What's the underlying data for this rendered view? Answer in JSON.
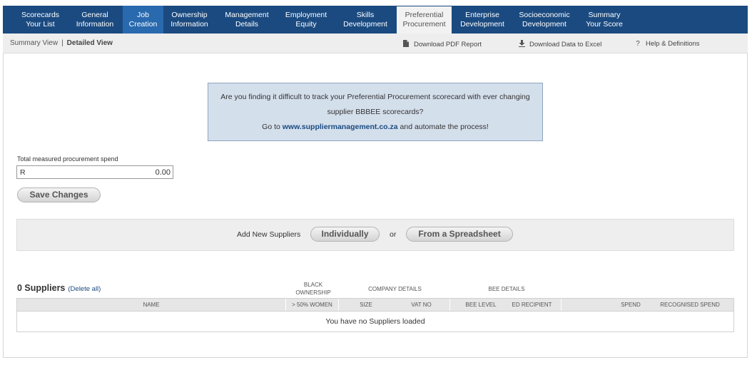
{
  "nav": {
    "tabs": [
      {
        "label": "Scorecards\nYour List"
      },
      {
        "label": "General\nInformation"
      },
      {
        "label": "Job\nCreation"
      },
      {
        "label": "Ownership\nInformation"
      },
      {
        "label": "Management\nDetails"
      },
      {
        "label": "Employment\nEquity"
      },
      {
        "label": "Skills\nDevelopment"
      },
      {
        "label": "Preferential\nProcurement"
      },
      {
        "label": "Enterprise\nDevelopment"
      },
      {
        "label": "Socioeconomic\nDevelopment"
      },
      {
        "label": "Summary\nYour Score"
      }
    ]
  },
  "subbar": {
    "summary_view": "Summary View",
    "separator": "|",
    "detailed_view": "Detailed View",
    "pdf_label": "Download PDF Report",
    "excel_label": "Download Data to Excel",
    "help_label": "Help & Definitions",
    "help_icon_glyph": "?"
  },
  "promo": {
    "line1": "Are you finding it difficult to track your Preferential Procurement scorecard with ever changing",
    "line2": "supplier BBBEE scorecards?",
    "line3_prefix": "Go to ",
    "line3_link": "www.suppliermanagement.co.za",
    "line3_suffix": " and automate the process!"
  },
  "spend": {
    "label": "Total measured procurement spend",
    "currency": "R",
    "value": "0.00"
  },
  "save_button": "Save Changes",
  "add_suppliers": {
    "label": "Add New Suppliers",
    "individually": "Individually",
    "or": "or",
    "spreadsheet": "From a Spreadsheet"
  },
  "suppliers": {
    "title": "0 Suppliers",
    "delete_all": "(Delete all)",
    "groups": {
      "black_ownership": "BLACK\nOWNERSHIP",
      "company_details": "COMPANY DETAILS",
      "bee_details": "BEE DETAILS"
    },
    "columns": {
      "name": "NAME",
      "women": "> 50% WOMEN",
      "size": "SIZE",
      "vat": "VAT NO",
      "bee_level": "BEE LEVEL",
      "ed_recipient": "ED RECIPIENT",
      "spend": "SPEND",
      "recognised": "RECOGNISED SPEND"
    },
    "empty_message": "You have no Suppliers loaded"
  },
  "colors": {
    "nav_bg": "#1a4a80",
    "nav_active": "#2969ae",
    "promo_bg": "#d4dfec",
    "link": "#1a4a80"
  }
}
